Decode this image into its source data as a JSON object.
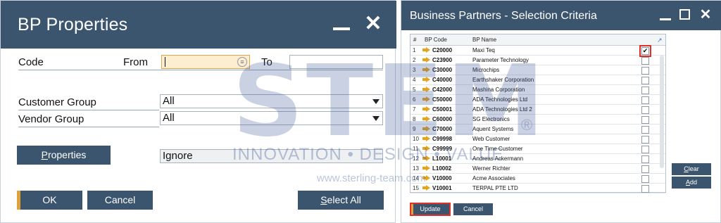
{
  "bp_properties": {
    "title": "BP Properties",
    "code_label": "Code",
    "from_label": "From",
    "from_value": "",
    "to_label": "To",
    "to_value": "",
    "customer_group_label": "Customer Group",
    "customer_group_value": "All",
    "vendor_group_label": "Vendor Group",
    "vendor_group_value": "All",
    "properties_button": {
      "underlined": "P",
      "rest": "roperties"
    },
    "properties_value": "Ignore",
    "ok_label": "OK",
    "cancel_label": "Cancel",
    "select_all_button": {
      "underlined": "S",
      "rest": "elect All"
    }
  },
  "selection_criteria": {
    "title": "Business Partners - Selection Criteria",
    "columns": {
      "num": "#",
      "code": "BP Code",
      "name": "BP Name"
    },
    "rows": [
      {
        "num": "1",
        "code": "C20000",
        "name": "Maxi Teq",
        "checked": true
      },
      {
        "num": "2",
        "code": "C23900",
        "name": "Parameter Technology",
        "checked": false
      },
      {
        "num": "3",
        "code": "C30000",
        "name": "Microchips",
        "checked": false
      },
      {
        "num": "4",
        "code": "C40000",
        "name": "Earthshaker Corporation",
        "checked": false
      },
      {
        "num": "5",
        "code": "C42000",
        "name": "Mashina Corporation",
        "checked": false
      },
      {
        "num": "6",
        "code": "C50000",
        "name": "ADA Technologies Ltd",
        "checked": false
      },
      {
        "num": "7",
        "code": "C50001",
        "name": "ADA Technologies Ltd 2",
        "checked": false
      },
      {
        "num": "8",
        "code": "C60000",
        "name": "SG Electronics",
        "checked": false
      },
      {
        "num": "9",
        "code": "C70000",
        "name": "Aquent Systems",
        "checked": false
      },
      {
        "num": "10",
        "code": "C99998",
        "name": "Web Customer",
        "checked": false
      },
      {
        "num": "11",
        "code": "C99999",
        "name": "One Time Customer",
        "checked": false
      },
      {
        "num": "12",
        "code": "L10001",
        "name": "Andreas Ackermann",
        "checked": false
      },
      {
        "num": "13",
        "code": "L10002",
        "name": "Werner Richter",
        "checked": false
      },
      {
        "num": "14",
        "code": "V10000",
        "name": "Acme Associates",
        "checked": false
      },
      {
        "num": "15",
        "code": "V10001",
        "name": "TERPAL PTE LTD",
        "checked": false
      }
    ],
    "check_mark": "✔",
    "clear_button": {
      "underlined": "C",
      "rest": "lear"
    },
    "add_button": {
      "underlined": "A",
      "rest": "dd"
    },
    "update_label": "Update",
    "cancel_label": "Cancel"
  },
  "watermark": {
    "letters": "STEM",
    "registered": "®",
    "tagline": "INNOVATION • DESIGN • VALUE",
    "url": "www.sterling-team.com"
  },
  "colors": {
    "title_bar": "#3c556f",
    "accent": "#e0a13a",
    "highlight_border": "#e0302a",
    "active_field": "#fdeed2"
  }
}
